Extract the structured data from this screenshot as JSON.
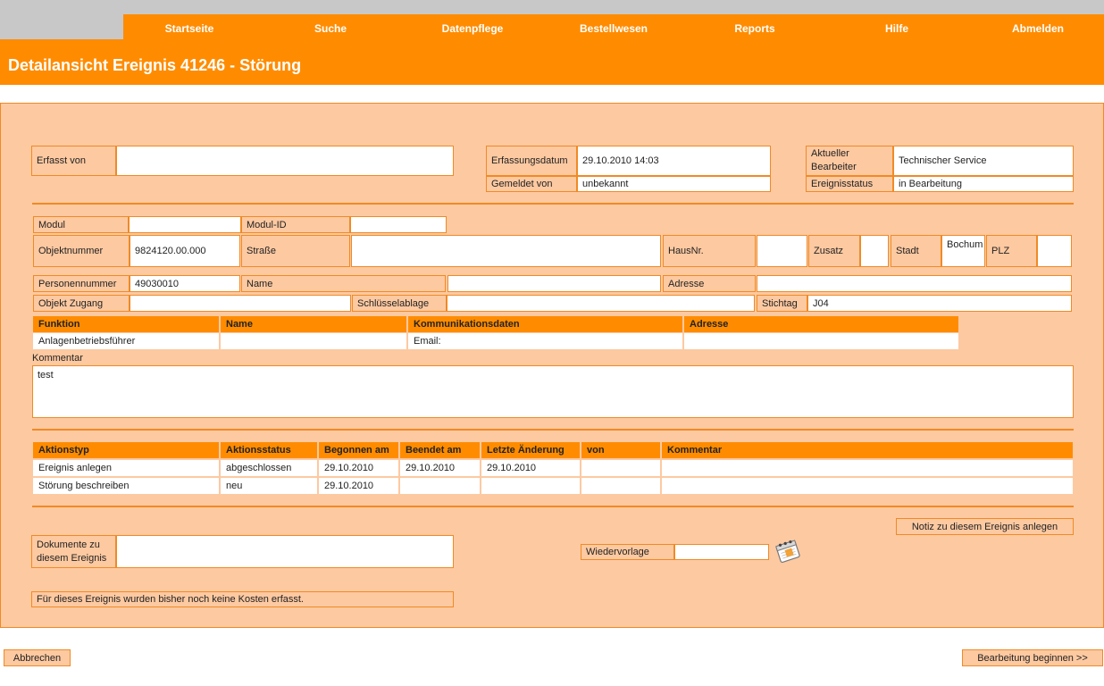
{
  "nav": {
    "items": [
      "Startseite",
      "Suche",
      "Datenpflege",
      "Bestellwesen",
      "Reports",
      "Hilfe",
      "Abmelden"
    ]
  },
  "page": {
    "title": "Detailansicht Ereignis 41246 - Störung"
  },
  "header": {
    "erfasst_von_label": "Erfasst von",
    "erfasst_von_value": "",
    "erfassungsdatum_label": "Erfassungsdatum",
    "erfassungsdatum_value": "29.10.2010 14:03",
    "gemeldet_von_label": "Gemeldet von",
    "gemeldet_von_value": "unbekannt",
    "bearbeiter_label": "Aktueller Bearbeiter",
    "bearbeiter_value": "Technischer Service",
    "status_label": "Ereignisstatus",
    "status_value": "in Bearbeitung"
  },
  "object": {
    "modul_label": "Modul",
    "modul_value": "",
    "modul_id_label": "Modul-ID",
    "modul_id_value": "",
    "objektnummer_label": "Objektnummer",
    "objektnummer_value": "9824120.00.000",
    "strasse_label": "Straße",
    "strasse_value": "",
    "hausnr_label": "HausNr.",
    "hausnr_value": "",
    "zusatz_label": "Zusatz",
    "zusatz_value": "",
    "stadt_label": "Stadt",
    "stadt_value": "Bochum",
    "plz_label": "PLZ",
    "plz_value": "",
    "personennummer_label": "Personennummer",
    "personennummer_value": "49030010",
    "name_label": "Name",
    "name_value": "",
    "adresse_label": "Adresse",
    "adresse_value": "",
    "zugang_label": "Objekt Zugang",
    "zugang_value": "",
    "schluessel_label": "Schlüsselablage",
    "schluessel_value": "",
    "stichtag_label": "Stichtag",
    "stichtag_value": "J04"
  },
  "contacts": {
    "headers": [
      "Funktion",
      "Name",
      "Kommunikationsdaten",
      "Adresse"
    ],
    "rows": [
      [
        "Anlagenbetriebsführer",
        "",
        "Email:",
        ""
      ]
    ]
  },
  "comment": {
    "label": "Kommentar",
    "value": "test"
  },
  "actions": {
    "headers": [
      "Aktionstyp",
      "Aktionsstatus",
      "Begonnen am",
      "Beendet am",
      "Letzte Änderung",
      "von",
      "Kommentar"
    ],
    "rows": [
      [
        "Ereignis anlegen",
        "abgeschlossen",
        "29.10.2010",
        "29.10.2010",
        "29.10.2010",
        "",
        ""
      ],
      [
        "Störung beschreiben",
        "neu",
        "29.10.2010",
        "",
        "",
        "",
        ""
      ]
    ]
  },
  "notiz_button": "Notiz zu diesem Ereignis anlegen",
  "documents": {
    "label": "Dokumente zu diesem Ereignis",
    "value": ""
  },
  "wiedervorlage": {
    "label": "Wiedervorlage",
    "value": ""
  },
  "kosten_text": "Für dieses Ereignis wurden bisher noch keine Kosten erfasst.",
  "buttons": {
    "cancel": "Abbrechen",
    "start": "Bearbeitung beginnen >>"
  },
  "colors": {
    "accent": "#ff8c00",
    "panel": "#fdc9a1",
    "border": "#f08a24"
  },
  "icons": {
    "calendar": "calendar-notepad-icon"
  }
}
